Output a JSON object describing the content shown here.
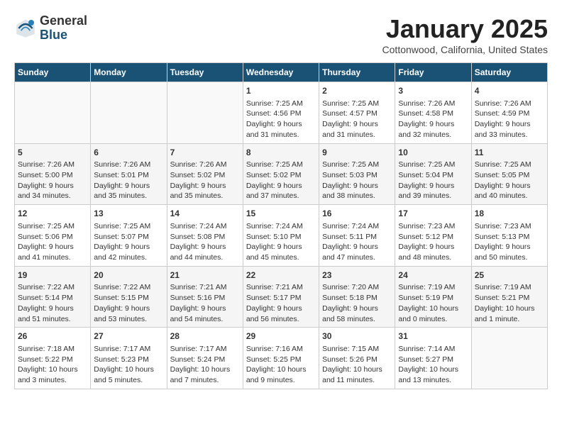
{
  "header": {
    "logo_line1": "General",
    "logo_line2": "Blue",
    "title": "January 2025",
    "subtitle": "Cottonwood, California, United States"
  },
  "days_of_week": [
    "Sunday",
    "Monday",
    "Tuesday",
    "Wednesday",
    "Thursday",
    "Friday",
    "Saturday"
  ],
  "weeks": [
    [
      {
        "day": "",
        "content": ""
      },
      {
        "day": "",
        "content": ""
      },
      {
        "day": "",
        "content": ""
      },
      {
        "day": "1",
        "content": "Sunrise: 7:25 AM\nSunset: 4:56 PM\nDaylight: 9 hours\nand 31 minutes."
      },
      {
        "day": "2",
        "content": "Sunrise: 7:25 AM\nSunset: 4:57 PM\nDaylight: 9 hours\nand 31 minutes."
      },
      {
        "day": "3",
        "content": "Sunrise: 7:26 AM\nSunset: 4:58 PM\nDaylight: 9 hours\nand 32 minutes."
      },
      {
        "day": "4",
        "content": "Sunrise: 7:26 AM\nSunset: 4:59 PM\nDaylight: 9 hours\nand 33 minutes."
      }
    ],
    [
      {
        "day": "5",
        "content": "Sunrise: 7:26 AM\nSunset: 5:00 PM\nDaylight: 9 hours\nand 34 minutes."
      },
      {
        "day": "6",
        "content": "Sunrise: 7:26 AM\nSunset: 5:01 PM\nDaylight: 9 hours\nand 35 minutes."
      },
      {
        "day": "7",
        "content": "Sunrise: 7:26 AM\nSunset: 5:02 PM\nDaylight: 9 hours\nand 35 minutes."
      },
      {
        "day": "8",
        "content": "Sunrise: 7:25 AM\nSunset: 5:02 PM\nDaylight: 9 hours\nand 37 minutes."
      },
      {
        "day": "9",
        "content": "Sunrise: 7:25 AM\nSunset: 5:03 PM\nDaylight: 9 hours\nand 38 minutes."
      },
      {
        "day": "10",
        "content": "Sunrise: 7:25 AM\nSunset: 5:04 PM\nDaylight: 9 hours\nand 39 minutes."
      },
      {
        "day": "11",
        "content": "Sunrise: 7:25 AM\nSunset: 5:05 PM\nDaylight: 9 hours\nand 40 minutes."
      }
    ],
    [
      {
        "day": "12",
        "content": "Sunrise: 7:25 AM\nSunset: 5:06 PM\nDaylight: 9 hours\nand 41 minutes."
      },
      {
        "day": "13",
        "content": "Sunrise: 7:25 AM\nSunset: 5:07 PM\nDaylight: 9 hours\nand 42 minutes."
      },
      {
        "day": "14",
        "content": "Sunrise: 7:24 AM\nSunset: 5:08 PM\nDaylight: 9 hours\nand 44 minutes."
      },
      {
        "day": "15",
        "content": "Sunrise: 7:24 AM\nSunset: 5:10 PM\nDaylight: 9 hours\nand 45 minutes."
      },
      {
        "day": "16",
        "content": "Sunrise: 7:24 AM\nSunset: 5:11 PM\nDaylight: 9 hours\nand 47 minutes."
      },
      {
        "day": "17",
        "content": "Sunrise: 7:23 AM\nSunset: 5:12 PM\nDaylight: 9 hours\nand 48 minutes."
      },
      {
        "day": "18",
        "content": "Sunrise: 7:23 AM\nSunset: 5:13 PM\nDaylight: 9 hours\nand 50 minutes."
      }
    ],
    [
      {
        "day": "19",
        "content": "Sunrise: 7:22 AM\nSunset: 5:14 PM\nDaylight: 9 hours\nand 51 minutes."
      },
      {
        "day": "20",
        "content": "Sunrise: 7:22 AM\nSunset: 5:15 PM\nDaylight: 9 hours\nand 53 minutes."
      },
      {
        "day": "21",
        "content": "Sunrise: 7:21 AM\nSunset: 5:16 PM\nDaylight: 9 hours\nand 54 minutes."
      },
      {
        "day": "22",
        "content": "Sunrise: 7:21 AM\nSunset: 5:17 PM\nDaylight: 9 hours\nand 56 minutes."
      },
      {
        "day": "23",
        "content": "Sunrise: 7:20 AM\nSunset: 5:18 PM\nDaylight: 9 hours\nand 58 minutes."
      },
      {
        "day": "24",
        "content": "Sunrise: 7:19 AM\nSunset: 5:19 PM\nDaylight: 10 hours\nand 0 minutes."
      },
      {
        "day": "25",
        "content": "Sunrise: 7:19 AM\nSunset: 5:21 PM\nDaylight: 10 hours\nand 1 minute."
      }
    ],
    [
      {
        "day": "26",
        "content": "Sunrise: 7:18 AM\nSunset: 5:22 PM\nDaylight: 10 hours\nand 3 minutes."
      },
      {
        "day": "27",
        "content": "Sunrise: 7:17 AM\nSunset: 5:23 PM\nDaylight: 10 hours\nand 5 minutes."
      },
      {
        "day": "28",
        "content": "Sunrise: 7:17 AM\nSunset: 5:24 PM\nDaylight: 10 hours\nand 7 minutes."
      },
      {
        "day": "29",
        "content": "Sunrise: 7:16 AM\nSunset: 5:25 PM\nDaylight: 10 hours\nand 9 minutes."
      },
      {
        "day": "30",
        "content": "Sunrise: 7:15 AM\nSunset: 5:26 PM\nDaylight: 10 hours\nand 11 minutes."
      },
      {
        "day": "31",
        "content": "Sunrise: 7:14 AM\nSunset: 5:27 PM\nDaylight: 10 hours\nand 13 minutes."
      },
      {
        "day": "",
        "content": ""
      }
    ]
  ]
}
